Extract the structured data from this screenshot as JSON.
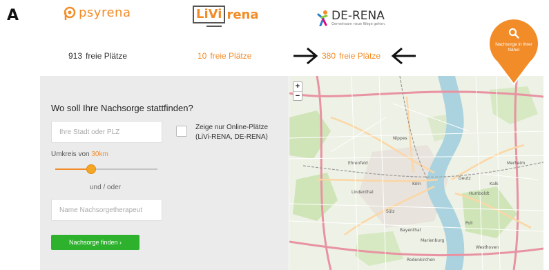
{
  "panel_letter": "A",
  "logos": {
    "psyrena": "psyrena",
    "livirena_box": "LiVi",
    "livirena_rest": "rena",
    "derena": "DE-RENA",
    "derena_tagline": "Gemeinsam neue Wege gehen."
  },
  "places": {
    "psyrena": {
      "count": "913",
      "label": "freie Plätze"
    },
    "livirena": {
      "count": "10",
      "label": "freie Plätze"
    },
    "derena": {
      "count": "380",
      "label": "freie Plätze"
    }
  },
  "form": {
    "title": "Wo soll Ihre Nachsorge stattfinden?",
    "city_placeholder": "Ihre Stadt oder PLZ",
    "online_only_label": "Zeige nur Online-Plätze (LiVi-RENA, DE-RENA)",
    "radius_prefix": "Umkreis von",
    "radius_value": "30km",
    "radius_fraction": 0.35,
    "or_label": "und / oder",
    "name_placeholder": "Name Nachsorgetherapeut",
    "search_button": "Nachsorge finden  ›"
  },
  "map": {
    "zoom_in": "+",
    "zoom_out": "−",
    "labels": [
      "Köln",
      "Deutz",
      "Ehrenfeld",
      "Nippes",
      "Sülz",
      "Lindenthal",
      "Humboldt",
      "Merheim",
      "Kalk",
      "Poll",
      "Bayenthal",
      "Marienburg",
      "Rodenkirchen",
      "Westhoven"
    ]
  },
  "pin": {
    "text": "Nachsorge in Ihrer Nähe!",
    "color": "#f28c28"
  },
  "colors": {
    "accent": "#f28c28",
    "button": "#2eb22e",
    "panel_bg": "#ebebeb"
  }
}
